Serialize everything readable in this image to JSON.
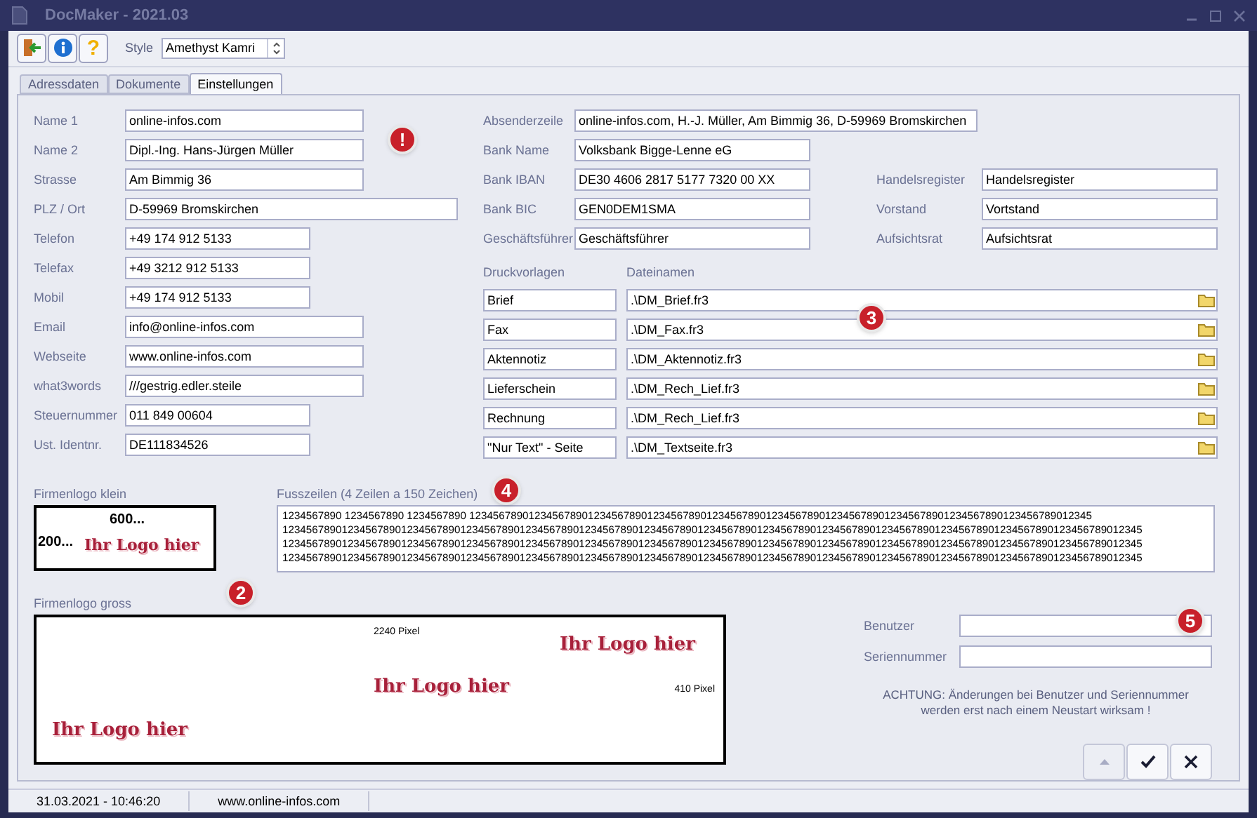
{
  "window": {
    "title": "DocMaker - 2021.03"
  },
  "toolbar": {
    "help_glyph": "?",
    "style_label": "Style",
    "style_value": "Amethyst Kamri"
  },
  "tabs": [
    {
      "label": "Adressdaten",
      "selected": false
    },
    {
      "label": "Dokumente",
      "selected": false
    },
    {
      "label": "Einstellungen",
      "selected": true
    }
  ],
  "address_fields": [
    {
      "label": "Name 1",
      "value": "online-infos.com"
    },
    {
      "label": "Name 2",
      "value": "Dipl.-Ing. Hans-Jürgen Müller"
    },
    {
      "label": "Strasse",
      "value": "Am Bimmig 36"
    },
    {
      "label": "PLZ / Ort",
      "value": "D-59969 Bromskirchen"
    },
    {
      "label": "Telefon",
      "value": "+49 174 912 5133"
    },
    {
      "label": "Telefax",
      "value": "+49 3212 912 5133"
    },
    {
      "label": "Mobil",
      "value": "+49 174 912 5133"
    },
    {
      "label": "Email",
      "value": "info@online-infos.com"
    },
    {
      "label": "Webseite",
      "value": "www.online-infos.com"
    },
    {
      "label": "what3words",
      "value": "///gestrig.edler.steile"
    },
    {
      "label": "Steuernummer",
      "value": "011 849 00604"
    },
    {
      "label": "Ust. Identnr.",
      "value": "DE111834526"
    }
  ],
  "bank_fields": [
    {
      "label": "Absenderzeile",
      "value": "online-infos.com, H.-J. Müller, Am Bimmig 36, D-59969 Bromskirchen"
    },
    {
      "label": "Bank Name",
      "value": "Volksbank Bigge-Lenne eG"
    },
    {
      "label": "Bank IBAN",
      "value": "DE30 4606 2817 5177 7320 00 XX"
    },
    {
      "label": "Bank BIC",
      "value": "GEN0DEM1SMA"
    },
    {
      "label": "Geschäftsführer",
      "value": "Geschäftsführer"
    }
  ],
  "register_fields": [
    {
      "label": "Handelsregister",
      "value": "Handelsregister"
    },
    {
      "label": "Vorstand",
      "value": "Vortstand"
    },
    {
      "label": "Aufsichtsrat",
      "value": "Aufsichtsrat"
    }
  ],
  "templates": {
    "name_header": "Druckvorlagen",
    "file_header": "Dateinamen",
    "rows": [
      {
        "name": "Brief",
        "file": ".\\DM_Brief.fr3"
      },
      {
        "name": "Fax",
        "file": ".\\DM_Fax.fr3"
      },
      {
        "name": "Aktennotiz",
        "file": ".\\DM_Aktennotiz.fr3"
      },
      {
        "name": "Lieferschein",
        "file": ".\\DM_Rech_Lief.fr3"
      },
      {
        "name": "Rechnung",
        "file": ".\\DM_Rech_Lief.fr3"
      },
      {
        "name": "\"Nur Text\" - Seite",
        "file": ".\\DM_Textseite.fr3"
      }
    ]
  },
  "logo_small": {
    "label": "Firmenlogo klein",
    "width_text": "600...",
    "height_text": "200...",
    "logo_text": "Ihr Logo hier"
  },
  "footer": {
    "label": "Fusszeilen (4 Zeilen a 150 Zeichen)",
    "lines": [
      "1234567890 1234567890 1234567890 123456789012345678901234567890123456789012345678901234567890123456789012345678901234567890123456789012345",
      "1234567890123456789012345678901234567890123456789012345678901234567890123456789012345678901234567890123456789012345678901234567890123456789012345",
      "1234567890123456789012345678901234567890123456789012345678901234567890123456789012345678901234567890123456789012345678901234567890123456789012345",
      "1234567890123456789012345678901234567890123456789012345678901234567890123456789012345678901234567890123456789012345678901234567890123456789012345"
    ]
  },
  "logo_large": {
    "label": "Firmenlogo gross",
    "width_text": "2240 Pixel",
    "height_text": "410 Pixel",
    "logo_texts": [
      "Ihr Logo hier",
      "Ihr Logo hier",
      "Ihr Logo hier"
    ]
  },
  "license": {
    "fields": [
      {
        "label": "Benutzer"
      },
      {
        "label": "Seriennummer"
      }
    ],
    "notice": [
      "ACHTUNG: Änderungen bei Benutzer und Seriennummer",
      "werden erst nach einem Neustart wirksam !"
    ]
  },
  "buttons": [
    {
      "kind": "up",
      "disabled": true
    },
    {
      "kind": "ok",
      "disabled": false
    },
    {
      "kind": "cancel",
      "disabled": false
    }
  ],
  "status_bar": [
    "31.03.2021 - 10:46:20",
    "www.online-infos.com"
  ],
  "callouts": [
    "!",
    "2",
    "3",
    "4",
    "5"
  ]
}
